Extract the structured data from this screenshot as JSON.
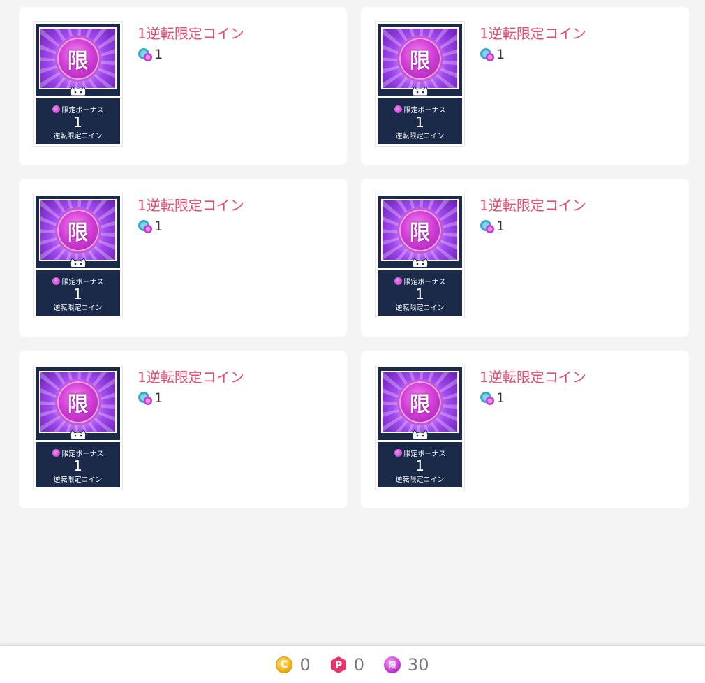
{
  "items": [
    {
      "title": "1逆転限定コイン",
      "price": "1",
      "coin_glyph": "限",
      "bonus_label": "限定ボーナス",
      "bonus_amount": "1",
      "bonus_name": "逆転限定コイン"
    },
    {
      "title": "1逆転限定コイン",
      "price": "1",
      "coin_glyph": "限",
      "bonus_label": "限定ボーナス",
      "bonus_amount": "1",
      "bonus_name": "逆転限定コイン"
    },
    {
      "title": "1逆転限定コイン",
      "price": "1",
      "coin_glyph": "限",
      "bonus_label": "限定ボーナス",
      "bonus_amount": "1",
      "bonus_name": "逆転限定コイン"
    },
    {
      "title": "1逆転限定コイン",
      "price": "1",
      "coin_glyph": "限",
      "bonus_label": "限定ボーナス",
      "bonus_amount": "1",
      "bonus_name": "逆転限定コイン"
    },
    {
      "title": "1逆転限定コイン",
      "price": "1",
      "coin_glyph": "限",
      "bonus_label": "限定ボーナス",
      "bonus_amount": "1",
      "bonus_name": "逆転限定コイン"
    },
    {
      "title": "1逆転限定コイン",
      "price": "1",
      "coin_glyph": "限",
      "bonus_label": "限定ボーナス",
      "bonus_amount": "1",
      "bonus_name": "逆転限定コイン"
    }
  ],
  "footer": {
    "coin_glyph": "C",
    "coin_balance": "0",
    "point_glyph": "P",
    "point_balance": "0",
    "limited_glyph": "限",
    "limited_balance": "30"
  },
  "colors": {
    "title": "#e64a6e",
    "background": "#f4f4f4",
    "card": "#ffffff",
    "thumb_panel": "#1b2a48"
  },
  "icons": {
    "price": "diamond-coin-icon",
    "footer_coin": "c-coin-icon",
    "footer_point": "p-point-icon",
    "footer_limited": "limited-coin-icon"
  }
}
